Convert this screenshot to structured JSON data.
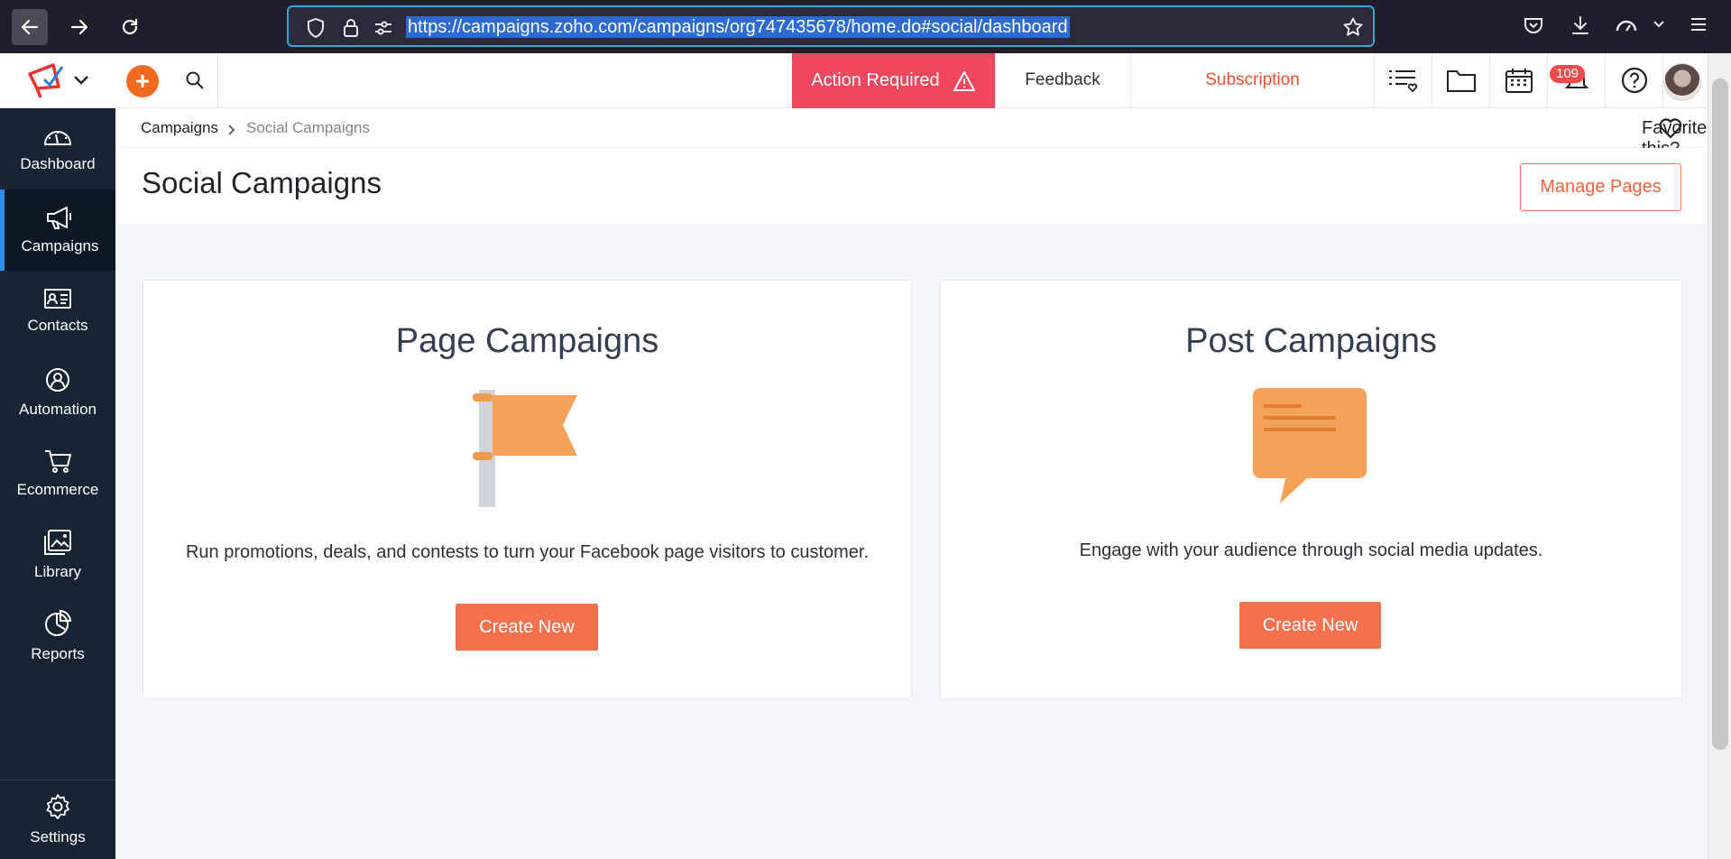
{
  "browser": {
    "url": "https://campaigns.zoho.com/campaigns/org747435678/home.do#social/dashboard"
  },
  "topbar": {
    "action_required": "Action Required",
    "feedback": "Feedback",
    "subscription": "Subscription",
    "notification_count": "109"
  },
  "sidebar": {
    "items": [
      {
        "label": "Dashboard",
        "icon": "dashboard-icon"
      },
      {
        "label": "Campaigns",
        "icon": "megaphone-icon",
        "active": true
      },
      {
        "label": "Contacts",
        "icon": "contacts-icon"
      },
      {
        "label": "Automation",
        "icon": "automation-icon"
      },
      {
        "label": "Ecommerce",
        "icon": "cart-icon"
      },
      {
        "label": "Library",
        "icon": "image-library-icon"
      },
      {
        "label": "Reports",
        "icon": "pie-chart-icon"
      }
    ],
    "settings": "Settings"
  },
  "breadcrumb": {
    "parent": "Campaigns",
    "current": "Social Campaigns",
    "favorite": "Favorite this?"
  },
  "header": {
    "title": "Social Campaigns",
    "manage_pages": "Manage Pages"
  },
  "cards": {
    "page": {
      "title": "Page Campaigns",
      "description": "Run promotions, deals, and contests to turn your Facebook page visitors to customer.",
      "button": "Create New"
    },
    "post": {
      "title": "Post Campaigns",
      "description": "Engage with your audience through social media updates.",
      "button": "Create New"
    }
  },
  "colors": {
    "accent": "#f6724f",
    "action_required": "#f0475f",
    "sidebar": "#172434",
    "illustration": "#f4a259"
  }
}
